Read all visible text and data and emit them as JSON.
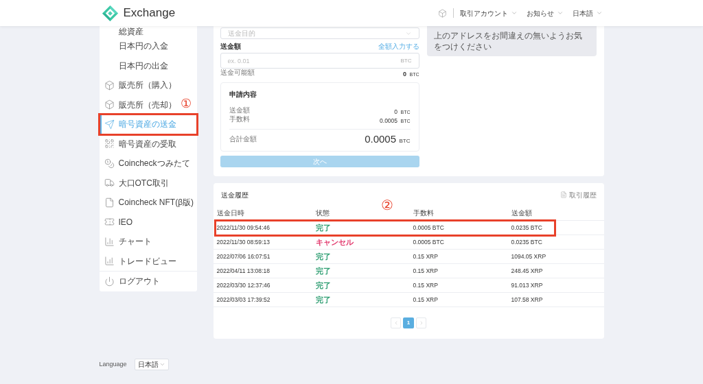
{
  "header": {
    "logo_text": "Exchange",
    "nav": [
      {
        "label": "取引アカウント"
      },
      {
        "label": "お知らせ"
      },
      {
        "label": "日本語"
      }
    ]
  },
  "sidebar": {
    "items": [
      {
        "label": "総資産",
        "kind": "sub",
        "selected": false
      },
      {
        "label": "日本円の入金",
        "kind": "sub",
        "selected": false
      },
      {
        "label": "日本円の出金",
        "kind": "sub",
        "selected": false
      },
      {
        "label": "販売所（購入）",
        "kind": "main",
        "selected": false
      },
      {
        "label": "販売所（売却）",
        "kind": "main",
        "selected": false
      },
      {
        "label": "暗号資産の送金",
        "kind": "main",
        "selected": true,
        "annotation": "①"
      },
      {
        "label": "暗号資産の受取",
        "kind": "main",
        "selected": false
      },
      {
        "label": "Coincheckつみたて",
        "kind": "main",
        "selected": false
      },
      {
        "label": "大口OTC取引",
        "kind": "main",
        "selected": false
      },
      {
        "label": "Coincheck NFT(β版)",
        "kind": "main",
        "selected": false
      },
      {
        "label": "IEO",
        "kind": "main",
        "selected": false
      },
      {
        "label": "チャート",
        "kind": "main",
        "selected": false
      },
      {
        "label": "トレードビュー",
        "kind": "main",
        "selected": false
      }
    ],
    "footer_items": [
      {
        "label": "ログアウト"
      }
    ]
  },
  "send_form": {
    "purpose_select": {
      "placeholder": "送金目的"
    },
    "amount": {
      "label": "送金額",
      "fill_all_link": "全額入力する",
      "placeholder": "ex. 0.01",
      "unit": "BTC"
    },
    "available": {
      "label": "送金可能額",
      "value": "0",
      "unit": "BTC"
    },
    "summary": {
      "title": "申請内容",
      "rows": [
        {
          "label": "送金額",
          "value": "0",
          "unit": "BTC"
        },
        {
          "label": "手数料",
          "value": "0.0005",
          "unit": "BTC"
        }
      ],
      "total": {
        "label": "合計金額",
        "value": "0.0005",
        "unit": "BTC"
      }
    },
    "next_button": {
      "label": "次へ",
      "disabled": true
    }
  },
  "notice": {
    "text": "上のアドレスをお間違えの無いようお気をつけください"
  },
  "history": {
    "title": "送金履歴",
    "link": "取引履歴",
    "columns": [
      "送金日時",
      "状態",
      "手数料",
      "送金額"
    ],
    "rows": [
      {
        "date": "2022/11/30 09:54:46",
        "status": {
          "label": "完了",
          "color": "#2e9e72"
        },
        "fee": "0.0005 BTC",
        "amount": "0.0235 BTC",
        "annotation": "②"
      },
      {
        "date": "2022/11/30 08:59:13",
        "status": {
          "label": "キャンセル",
          "color": "#e23a6e"
        },
        "fee": "0.0005 BTC",
        "amount": "0.0235 BTC"
      },
      {
        "date": "2022/07/06 16:07:51",
        "status": {
          "label": "完了",
          "color": "#2e9e72"
        },
        "fee": "0.15 XRP",
        "amount": "1094.05 XRP"
      },
      {
        "date": "2022/04/11 13:08:18",
        "status": {
          "label": "完了",
          "color": "#2e9e72"
        },
        "fee": "0.15 XRP",
        "amount": "248.45 XRP"
      },
      {
        "date": "2022/03/30 12:37:46",
        "status": {
          "label": "完了",
          "color": "#2e9e72"
        },
        "fee": "0.15 XRP",
        "amount": "91.013 XRP"
      },
      {
        "date": "2022/03/03 17:39:52",
        "status": {
          "label": "完了",
          "color": "#2e9e72"
        },
        "fee": "0.15 XRP",
        "amount": "107.58 XRP"
      }
    ],
    "pagination": {
      "pages": [
        {
          "label": "1",
          "selected": true
        }
      ]
    }
  },
  "footer": {
    "language_label": "Language",
    "language_value": "日本語"
  }
}
